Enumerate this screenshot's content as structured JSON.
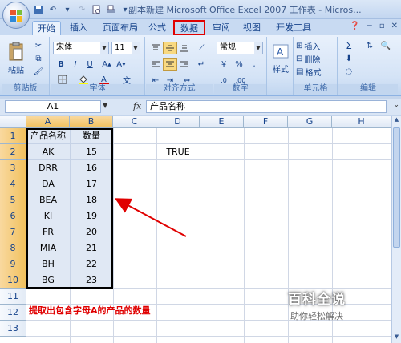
{
  "window": {
    "title": "副本新建 Microsoft Office Excel 2007 工作表 - Micros..."
  },
  "tabs": [
    "开始",
    "插入",
    "页面布局",
    "公式",
    "数据",
    "审阅",
    "视图",
    "开发工具"
  ],
  "ribbon": {
    "clipboard": {
      "paste_label": "粘贴",
      "group_label": "剪贴板"
    },
    "font": {
      "name": "宋体",
      "size": "11",
      "group_label": "字体",
      "bold": "B",
      "italic": "I",
      "underline": "U",
      "wen": "文"
    },
    "alignment": {
      "group_label": "对齐方式"
    },
    "number": {
      "format": "常规",
      "group_label": "数字",
      "percent": "%",
      "comma": ",",
      "currency": "¥",
      "dec_inc": ".0",
      "dec_dec": ".00"
    },
    "styles": {
      "label": "样式"
    },
    "cells": {
      "insert": "插入",
      "delete": "删除",
      "format": "格式",
      "group_label": "单元格"
    },
    "editing": {
      "sigma": "Σ",
      "group_label": "编辑"
    }
  },
  "formula_bar": {
    "name_box": "A1",
    "fx": "fx",
    "formula": "产品名称"
  },
  "sheet": {
    "columns": [
      "A",
      "B",
      "C",
      "D",
      "E",
      "F",
      "G",
      "H"
    ],
    "rows": [
      "1",
      "2",
      "3",
      "4",
      "5",
      "6",
      "7",
      "8",
      "9",
      "10",
      "11",
      "12",
      "13"
    ],
    "data": [
      [
        "产品名称",
        "数量"
      ],
      [
        "AK",
        "15"
      ],
      [
        "DRR",
        "16"
      ],
      [
        "DA",
        "17"
      ],
      [
        "BEA",
        "18"
      ],
      [
        "KI",
        "19"
      ],
      [
        "FR",
        "20"
      ],
      [
        "MIA",
        "21"
      ],
      [
        "BH",
        "22"
      ],
      [
        "BG",
        "23"
      ]
    ],
    "d2": "TRUE",
    "a12": "提取出包含字母A的产品的数量"
  },
  "watermark": {
    "title": "百科全说",
    "subtitle": "助你轻松解决"
  },
  "colors": {
    "highlight": "#e00000",
    "selection_border": "#000000",
    "arrow": "#e00000"
  }
}
